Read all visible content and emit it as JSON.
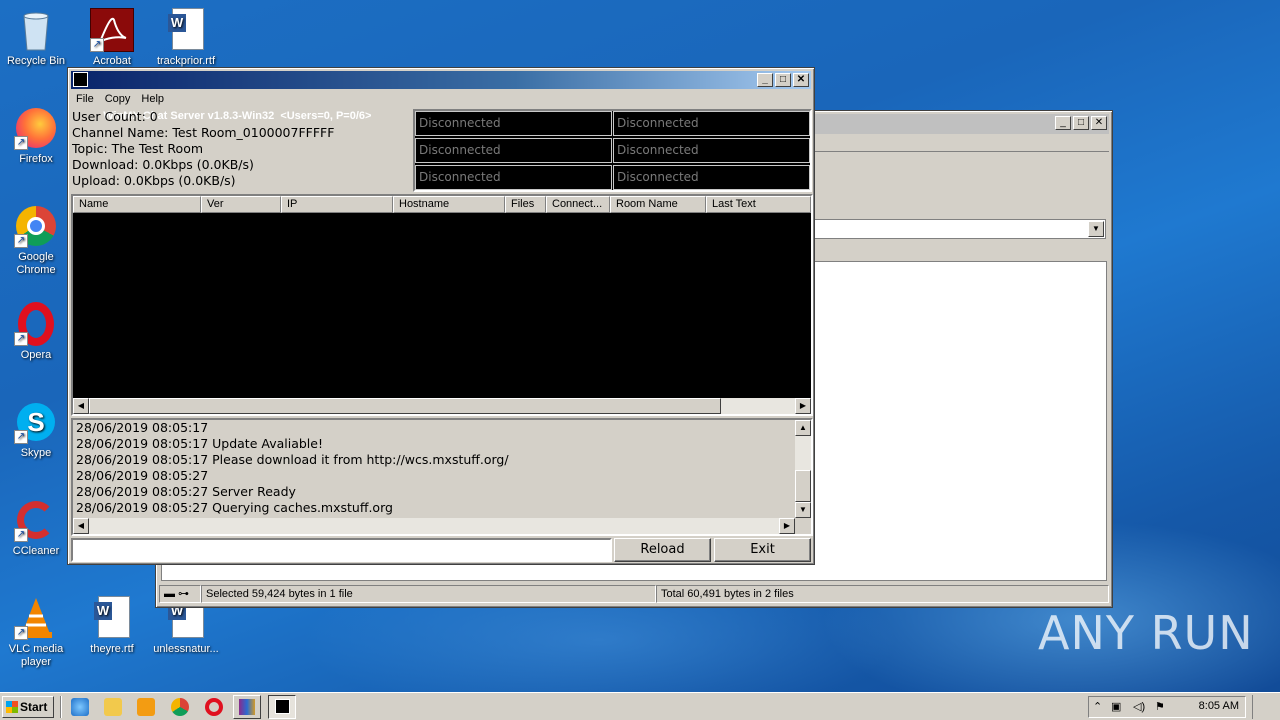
{
  "desktop": {
    "icons": [
      {
        "label": "Recycle Bin"
      },
      {
        "label": "Acrobat"
      },
      {
        "label": "trackprior.rtf"
      },
      {
        "label": "Firefox"
      },
      {
        "label": "Google Chrome"
      },
      {
        "label": "Opera"
      },
      {
        "label": "Skype"
      },
      {
        "label": "CCleaner"
      },
      {
        "label": "VLC media player"
      },
      {
        "label": "theyre.rtf"
      },
      {
        "label": "unlessnatur..."
      }
    ],
    "watermark": "ANY RUN"
  },
  "explorer": {
    "status_left": "Selected 59,424 bytes in 1 file",
    "status_right": "Total 60,491 bytes in 2 files"
  },
  "winmx": {
    "title": "WinMX Chat Server v1.8.3-Win32  <Users=0, P=0/6>",
    "menu": [
      "File",
      "Copy",
      "Help"
    ],
    "info": {
      "user_count": "User Count: 0",
      "channel_name": "Channel Name: Test Room_0100007FFFFF",
      "topic": "Topic: The Test Room",
      "download": "Download: 0.0Kbps (0.0KB/s)",
      "upload": "Upload: 0.0Kbps (0.0KB/s)"
    },
    "connections": [
      "Disconnected",
      "Disconnected",
      "Disconnected",
      "Disconnected",
      "Disconnected",
      "Disconnected"
    ],
    "columns": [
      "Name",
      "Ver",
      "IP",
      "Hostname",
      "Files",
      "Connect...",
      "Room Name",
      "Last Text"
    ],
    "log": [
      "28/06/2019 08:05:17",
      "28/06/2019 08:05:17 Update Avaliable!",
      "28/06/2019 08:05:17 Please download it from http://wcs.mxstuff.org/",
      "28/06/2019 08:05:27",
      "28/06/2019 08:05:27 Server Ready",
      "28/06/2019 08:05:27 Querying caches.mxstuff.org"
    ],
    "command_value": "",
    "reload_label": "Reload",
    "exit_label": "Exit"
  },
  "taskbar": {
    "start_label": "Start",
    "clock": "8:05 AM"
  }
}
